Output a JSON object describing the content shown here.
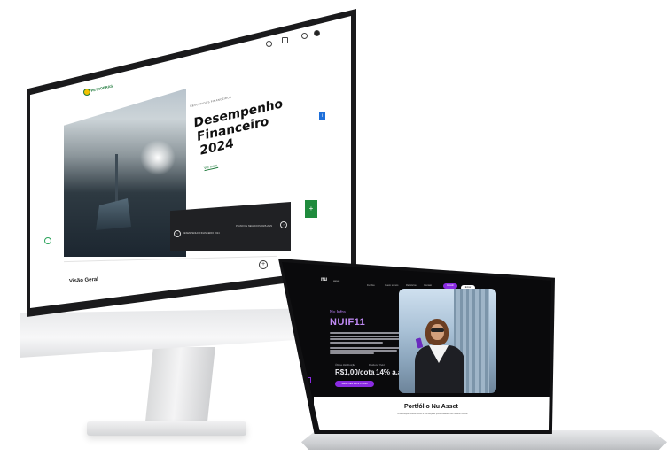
{
  "monitor": {
    "screen": {
      "logo_text": "PETROBRAS",
      "eyebrow": "RESULTADOS FINANCEIROS",
      "title_line1": "Desempenho Financeiro",
      "title_line2": "2024",
      "tag": "Ver mais",
      "panel_left_label": "DESEMPENHO FINANCEIRO 2024",
      "panel_right_label": "PLANO DE NEGÓCIOS 2025-2029",
      "section_label": "Visão Geral",
      "plus_symbol": "+",
      "green_button_symbol": "+",
      "blue_button_symbol": "i"
    }
  },
  "laptop": {
    "screen": {
      "logo": "nu",
      "brand": "asset",
      "nav_items": [
        "Fundos",
        "Quem somos",
        "Relatórios",
        "Contato"
      ],
      "nav_primary_button": "Investir",
      "nav_secondary_button": "Entrar",
      "eyebrow": "Nu Infra",
      "ticker": "NUIF11",
      "paragraph_1": "O NUIF11 é o nosso fundo de infraestrutura...",
      "paragraph_2": "Em 2024, o fundo distribuiu rendimentos...",
      "stat_1_label": "Última distribuição",
      "stat_1_value": "R$1,00/cota",
      "stat_2_label": "Dividend Yield",
      "stat_2_value": "14% a.a.",
      "cta_label": "Saiba mais sobre o fundo",
      "section_title": "Portfólio Nu Asset",
      "section_subtitle": "Diversifique investimentos e conheça as possibilidades dos nossos fundos"
    }
  }
}
